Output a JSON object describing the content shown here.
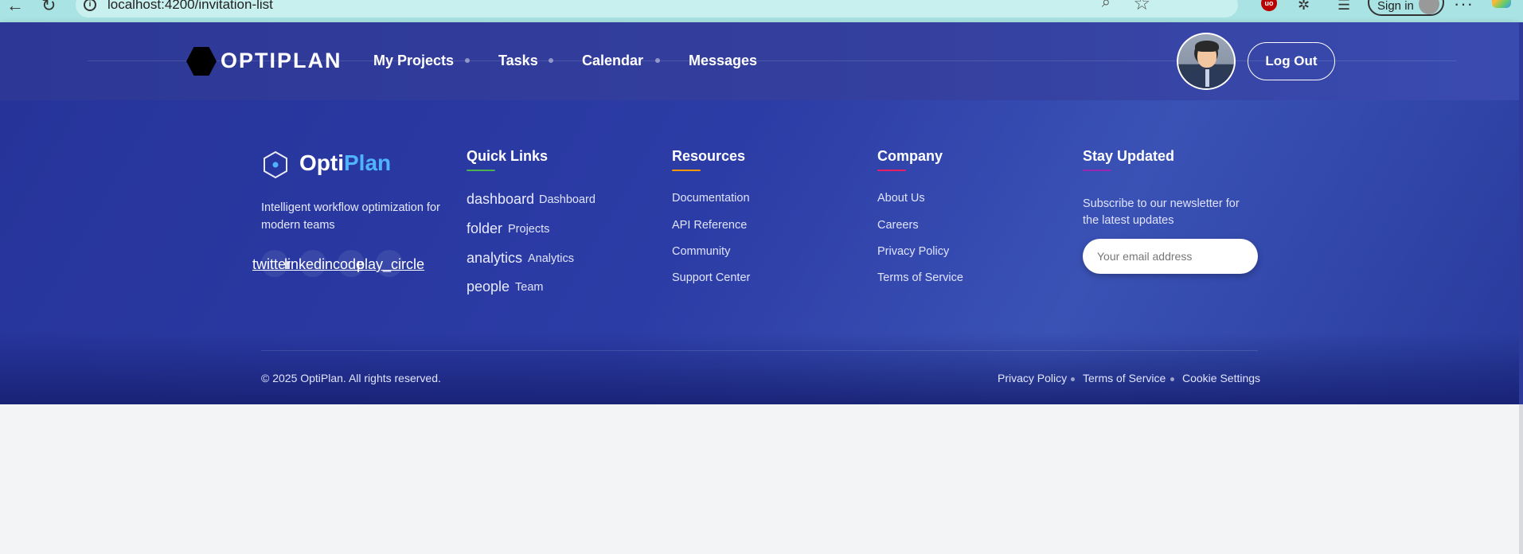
{
  "browser": {
    "url": "localhost:4200/invitation-list",
    "sign_in_label": "Sign in"
  },
  "header": {
    "brand": "OPTIPLAN",
    "nav": [
      {
        "label": "My Projects"
      },
      {
        "label": "Tasks"
      },
      {
        "label": "Calendar"
      },
      {
        "label": "Messages"
      }
    ],
    "logout_label": "Log Out"
  },
  "footer": {
    "brand_part1": "Opti",
    "brand_part2": "Plan",
    "tagline": "Intelligent workflow optimization for modern teams",
    "socials": [
      "twitter",
      "linkedin",
      "code",
      "play_circle"
    ],
    "quick_links": {
      "title": "Quick Links",
      "accent": "#4caf50",
      "items": [
        {
          "icon": "dashboard",
          "label": "Dashboard"
        },
        {
          "icon": "folder",
          "label": "Projects"
        },
        {
          "icon": "analytics",
          "label": "Analytics"
        },
        {
          "icon": "people",
          "label": "Team"
        }
      ]
    },
    "resources": {
      "title": "Resources",
      "accent": "#ff9800",
      "items": [
        "Documentation",
        "API Reference",
        "Community",
        "Support Center"
      ]
    },
    "company": {
      "title": "Company",
      "accent": "#e91e63",
      "items": [
        "About Us",
        "Careers",
        "Privacy Policy",
        "Terms of Service"
      ]
    },
    "stay_updated": {
      "title": "Stay Updated",
      "accent": "#9c27b0",
      "text": "Subscribe to our newsletter for the latest updates",
      "email_placeholder": "Your email address"
    },
    "copyright": "© 2025 OptiPlan. All rights reserved.",
    "bottom_links": [
      "Privacy Policy",
      "Terms of Service",
      "Cookie Settings"
    ]
  }
}
